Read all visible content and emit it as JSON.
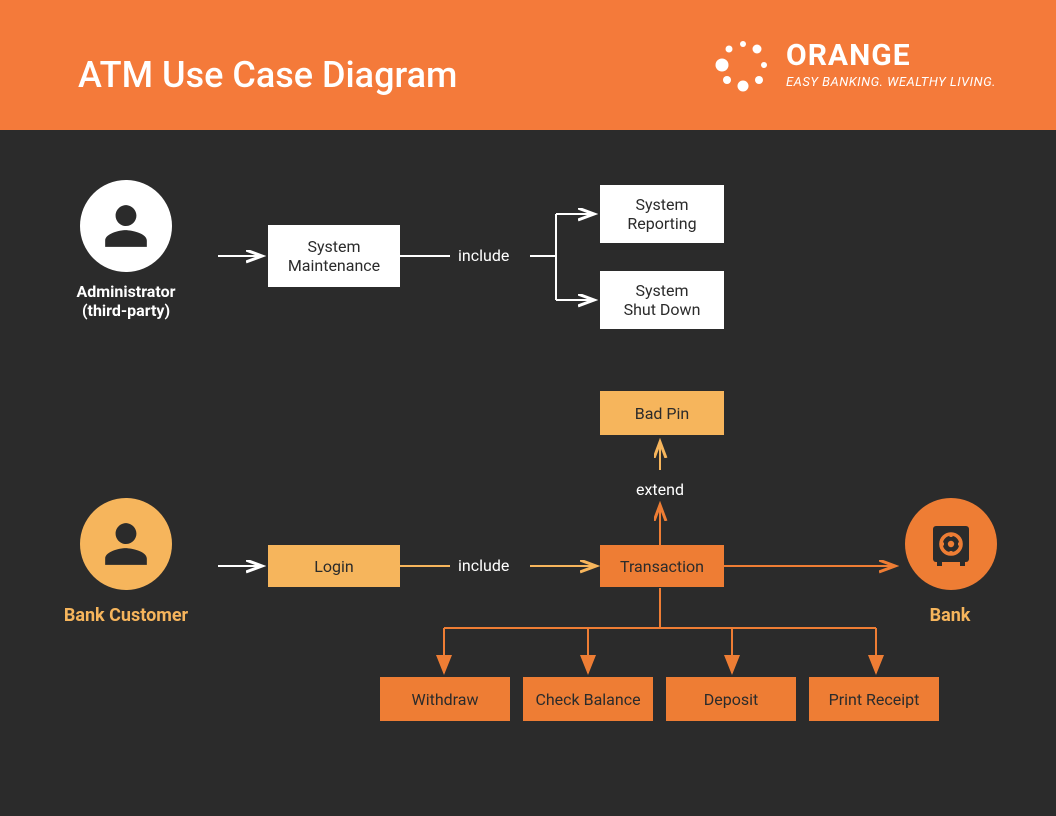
{
  "header": {
    "title": "ATM Use Case Diagram",
    "brand_name": "ORANGE",
    "brand_tagline": "EASY BANKING. WEALTHY LIVING."
  },
  "actors": {
    "admin": {
      "label_line1": "Administrator",
      "label_line2": "(third-party)"
    },
    "customer": {
      "label": "Bank Customer"
    },
    "bank": {
      "label": "Bank"
    }
  },
  "nodes": {
    "sys_maintenance": "System\nMaintenance",
    "sys_reporting": "System\nReporting",
    "sys_shutdown": "System\nShut Down",
    "login": "Login",
    "bad_pin": "Bad Pin",
    "transaction": "Transaction",
    "withdraw": "Withdraw",
    "check_balance": "Check Balance",
    "deposit": "Deposit",
    "print_receipt": "Print Receipt"
  },
  "relations": {
    "include1": "include",
    "include2": "include",
    "extend": "extend"
  },
  "colors": {
    "header_bg": "#f47a3a",
    "canvas_bg": "#2b2b2b",
    "orange": "#ee7d34",
    "orange_light": "#f6b55c",
    "white": "#ffffff"
  }
}
